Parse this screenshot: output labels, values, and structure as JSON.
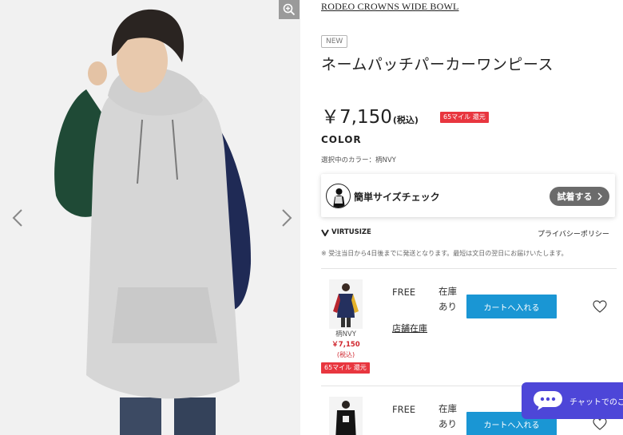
{
  "gallery": {
    "zoom_icon": "zoom-in-icon",
    "prev_icon": "chevron-left-icon",
    "next_icon": "chevron-right-icon"
  },
  "product": {
    "brand": "RODEO CROWNS WIDE BOWL",
    "badge": "NEW",
    "title": "ネームパッチパーカーワンピース",
    "price": "￥7,150",
    "price_tax": "(税込)",
    "mile_badge": "65マイル 還元",
    "color_heading": "COLOR",
    "selected_color": "選択中のカラー：柄NVY"
  },
  "size_check": {
    "label": "簡単サイズチェック",
    "button": "試着する"
  },
  "virtusize": {
    "label": "VIRTUSIZE",
    "privacy": "プライバシーポリシー",
    "notice": "※ 受注当日から4日後までに発送となります。最短は文日の翌日にお届けいたします。"
  },
  "variants": [
    {
      "color_name": "柄NVY",
      "price": "￥7,150",
      "tax": "(税込)",
      "mile": "65マイル 還元",
      "size": "FREE",
      "stock_line1": "在庫",
      "stock_line2": "あり",
      "cart_label": "カートへ入れる",
      "store_stock": "店舗在庫"
    },
    {
      "size": "FREE",
      "stock_line1": "在庫",
      "stock_line2": "あり",
      "cart_label": "カートへ入れる"
    }
  ],
  "chat": {
    "label": "チャットでのご"
  },
  "colors": {
    "cart_blue": "#1a96d4",
    "mile_red": "#e8363f",
    "chat_purple": "#4d46d8"
  }
}
